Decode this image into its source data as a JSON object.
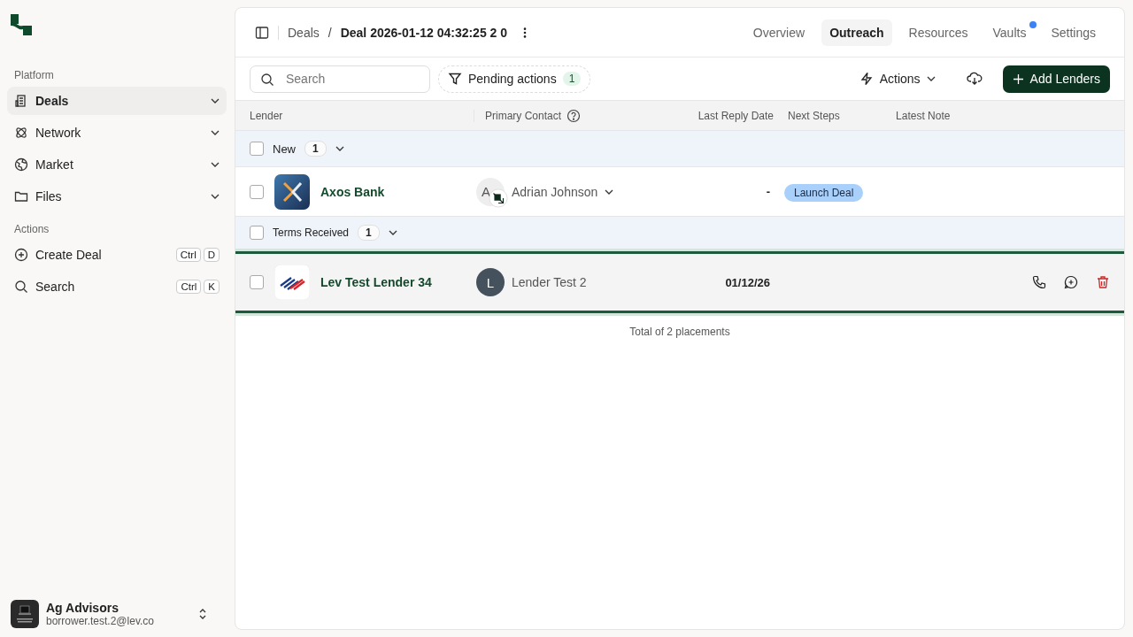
{
  "sidebar": {
    "sections": [
      {
        "title": "Platform",
        "items": [
          {
            "label": "Deals",
            "selected": true
          },
          {
            "label": "Network",
            "selected": false
          },
          {
            "label": "Market",
            "selected": false
          },
          {
            "label": "Files",
            "selected": false
          }
        ]
      },
      {
        "title": "Actions",
        "items": [
          {
            "label": "Create Deal",
            "shortcut": [
              "Ctrl",
              "D"
            ]
          },
          {
            "label": "Search",
            "shortcut": [
              "Ctrl",
              "K"
            ]
          }
        ]
      }
    ],
    "account": {
      "name": "Ag Advisors",
      "email": "borrower.test.2@lev.co"
    }
  },
  "header": {
    "breadcrumb": [
      "Deals",
      "Deal 2026-01-12 04:32:25 2 0"
    ],
    "separator": "/",
    "tabs": [
      {
        "label": "Overview",
        "selected": false,
        "dot": false
      },
      {
        "label": "Outreach",
        "selected": true,
        "dot": false
      },
      {
        "label": "Resources",
        "selected": false,
        "dot": false
      },
      {
        "label": "Vaults",
        "selected": false,
        "dot": true
      },
      {
        "label": "Settings",
        "selected": false,
        "dot": false
      }
    ]
  },
  "toolbar": {
    "search": {
      "placeholder": "Search"
    },
    "filter": {
      "label": "Pending actions",
      "count": "1"
    },
    "actions": "Actions",
    "add": "Add Lenders"
  },
  "table": {
    "columns": [
      "Lender",
      "Primary Contact",
      "Last Reply Date",
      "Next Steps",
      "Latest Note"
    ],
    "groups": [
      {
        "label": "New",
        "count": "1",
        "checked": false,
        "rows": [
          {
            "lender": "Axos Bank",
            "contact_initial": "A",
            "contact": "Adrian Johnson",
            "contact_dropdown": true,
            "last_reply": "-",
            "next_step": "Launch Deal",
            "checked": false,
            "selected": false,
            "actions": false
          }
        ]
      },
      {
        "label": "Terms Received",
        "count": "1",
        "checked": false,
        "rows": [
          {
            "lender": "Lev Test Lender 34",
            "contact_initial": "L",
            "contact": "Lender Test 2",
            "contact_dropdown": false,
            "last_reply": "01/12/26",
            "checked": false,
            "selected": true,
            "actions": true
          }
        ]
      }
    ],
    "footer": "Total of 2 placements"
  }
}
